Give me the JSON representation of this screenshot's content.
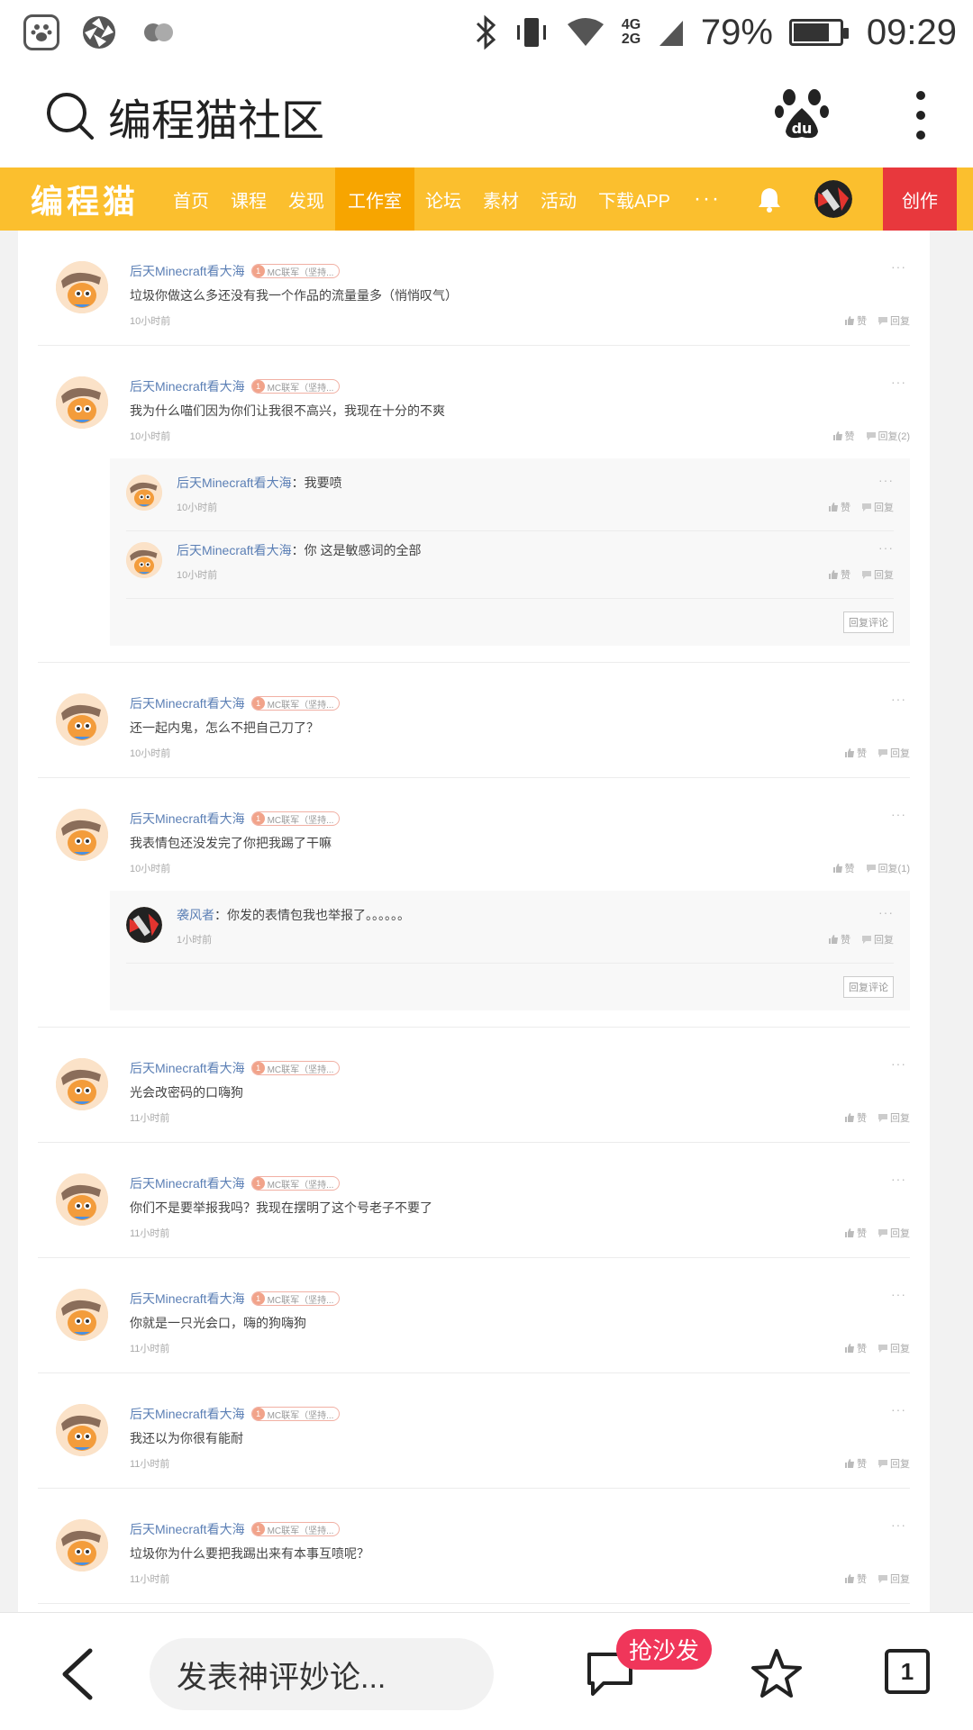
{
  "status_bar": {
    "network": "4G 2G",
    "battery": "79%",
    "battery_fraction": 0.79,
    "time": "09:29"
  },
  "browser": {
    "title": "编程猫社区"
  },
  "nav": {
    "logo": "编程猫",
    "items": [
      "首页",
      "课程",
      "发现",
      "工作室",
      "论坛",
      "素材",
      "活动",
      "下载APP"
    ],
    "active": "工作室",
    "more": "···",
    "create": "创作"
  },
  "comments": [
    {
      "user": "后天Minecraft看大海",
      "badge_level": "1",
      "badge": "MC联军（坚持...",
      "text": "垃圾你做这么多还没有我一个作品的流量量多（悄悄叹气）",
      "time": "10小时前",
      "like": "赞",
      "reply": "回复"
    },
    {
      "user": "后天Minecraft看大海",
      "badge_level": "1",
      "badge": "MC联军（坚持...",
      "text": "我为什么喵们因为你们让我很不高兴，我现在十分的不爽",
      "time": "10小时前",
      "like": "赞",
      "reply": "回复(2)",
      "replies": [
        {
          "user": "后天Minecraft看大海",
          "text": "：我要喷",
          "time": "10小时前",
          "like": "赞",
          "reply": "回复"
        },
        {
          "user": "后天Minecraft看大海",
          "text": "：你 这是敏感词的全部",
          "time": "10小时前",
          "like": "赞",
          "reply": "回复"
        }
      ],
      "reply_button": "回复评论"
    },
    {
      "user": "后天Minecraft看大海",
      "badge_level": "1",
      "badge": "MC联军（坚持...",
      "text": "还一起内鬼，怎么不把自己刀了？",
      "time": "10小时前",
      "like": "赞",
      "reply": "回复"
    },
    {
      "user": "后天Minecraft看大海",
      "badge_level": "1",
      "badge": "MC联军（坚持...",
      "text": "我表情包还没发完了你把我踢了干嘛",
      "time": "10小时前",
      "like": "赞",
      "reply": "回复(1)",
      "replies": [
        {
          "user": "袭风者",
          "text": "：你发的表情包我也举报了。。。。。。",
          "time": "1小时前",
          "like": "赞",
          "reply": "回复"
        }
      ],
      "reply_button": "回复评论"
    },
    {
      "user": "后天Minecraft看大海",
      "badge_level": "1",
      "badge": "MC联军（坚持...",
      "text": "光会改密码的口嗨狗",
      "time": "11小时前",
      "like": "赞",
      "reply": "回复"
    },
    {
      "user": "后天Minecraft看大海",
      "badge_level": "1",
      "badge": "MC联军（坚持...",
      "text": "你们不是要举报我吗？我现在摆明了这个号老子不要了",
      "time": "11小时前",
      "like": "赞",
      "reply": "回复"
    },
    {
      "user": "后天Minecraft看大海",
      "badge_level": "1",
      "badge": "MC联军（坚持...",
      "text": "你就是一只光会口，嗨的狗嗨狗",
      "time": "11小时前",
      "like": "赞",
      "reply": "回复"
    },
    {
      "user": "后天Minecraft看大海",
      "badge_level": "1",
      "badge": "MC联军（坚持...",
      "text": "我还以为你很有能耐",
      "time": "11小时前",
      "like": "赞",
      "reply": "回复"
    },
    {
      "user": "后天Minecraft看大海",
      "badge_level": "1",
      "badge": "MC联军（坚持...",
      "text": "垃圾你为什么要把我踢出来有本事互喷呢？",
      "time": "11小时前",
      "like": "赞",
      "reply": "回复"
    }
  ],
  "bottom_bar": {
    "input_placeholder": "发表神评妙论...",
    "sofa_badge": "抢沙发",
    "tab_count": "1"
  }
}
